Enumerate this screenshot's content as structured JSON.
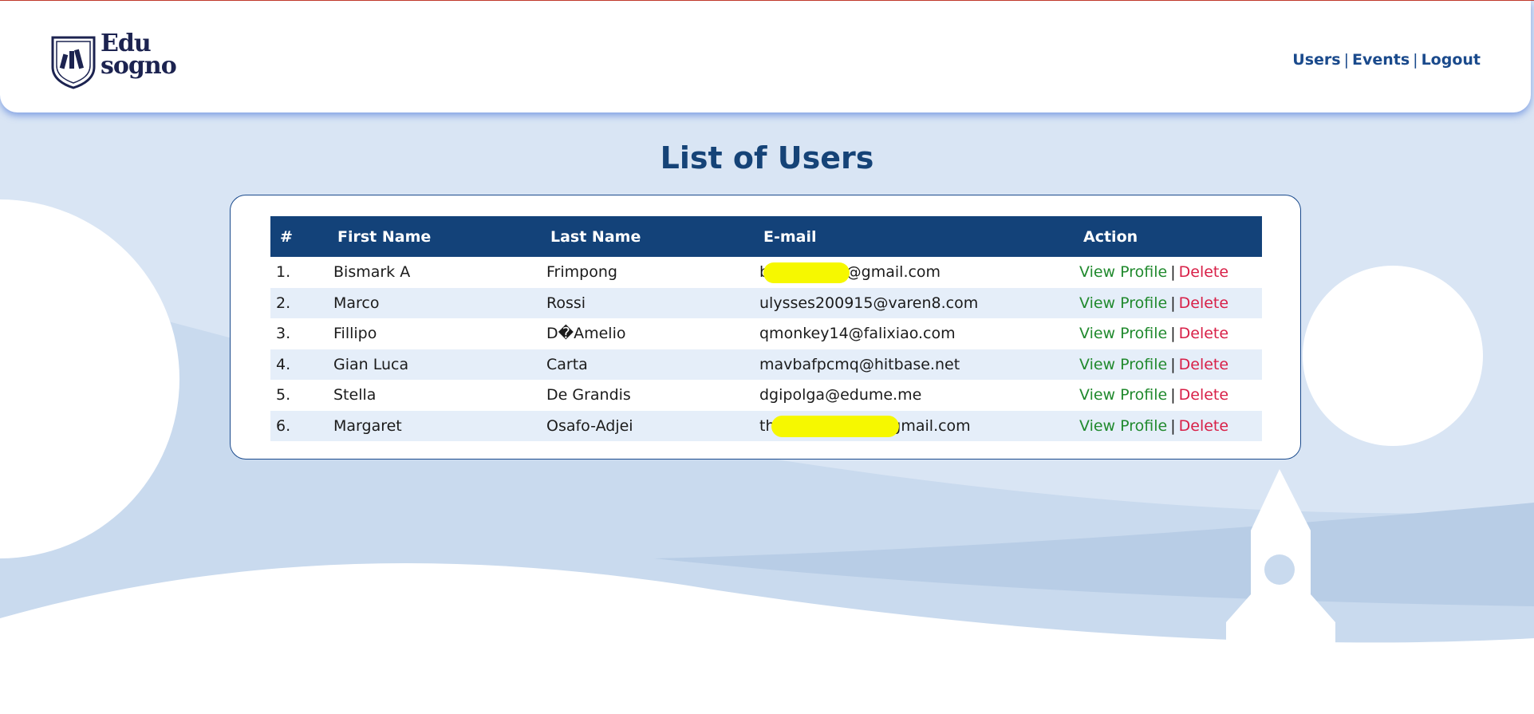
{
  "brand": {
    "line1": "Edu",
    "line2": "sogno"
  },
  "nav": {
    "items": [
      "Users",
      "Events",
      "Logout"
    ],
    "separator": "|"
  },
  "page_title": "List of Users",
  "table": {
    "columns": [
      "#",
      "First Name",
      "Last Name",
      "E-mail",
      "Action"
    ],
    "rows": [
      {
        "index": "1.",
        "first": "Bismark A",
        "last": "Frimpong",
        "email": "b              g@gmail.com",
        "view": "View Profile",
        "delete": "Delete"
      },
      {
        "index": "2.",
        "first": "Marco",
        "last": "Rossi",
        "email": "ulysses200915@varen8.com",
        "view": "View Profile",
        "delete": "Delete"
      },
      {
        "index": "3.",
        "first": "Fillipo",
        "last": "D�Amelio",
        "email": "qmonkey14@falixiao.com",
        "view": "View Profile",
        "delete": "Delete"
      },
      {
        "index": "4.",
        "first": "Gian Luca",
        "last": "Carta",
        "email": "mavbafpcmq@hitbase.net",
        "view": "View Profile",
        "delete": "Delete"
      },
      {
        "index": "5.",
        "first": "Stella",
        "last": "De Grandis",
        "email": "dgipolga@edume.me",
        "view": "View Profile",
        "delete": "Delete"
      },
      {
        "index": "6.",
        "first": "Margaret",
        "last": "Osafo-Adjei",
        "email": "th              dme@gmail.com",
        "view": "View Profile",
        "delete": "Delete"
      }
    ],
    "action_separator": "|"
  },
  "colors": {
    "page_bg": "#d9e5f4",
    "header_bg": "#ffffff",
    "table_header_bg": "#134279",
    "title": "#154377",
    "view_link": "#218a2e",
    "delete_link": "#d81f47",
    "highlight": "#f6f800"
  }
}
